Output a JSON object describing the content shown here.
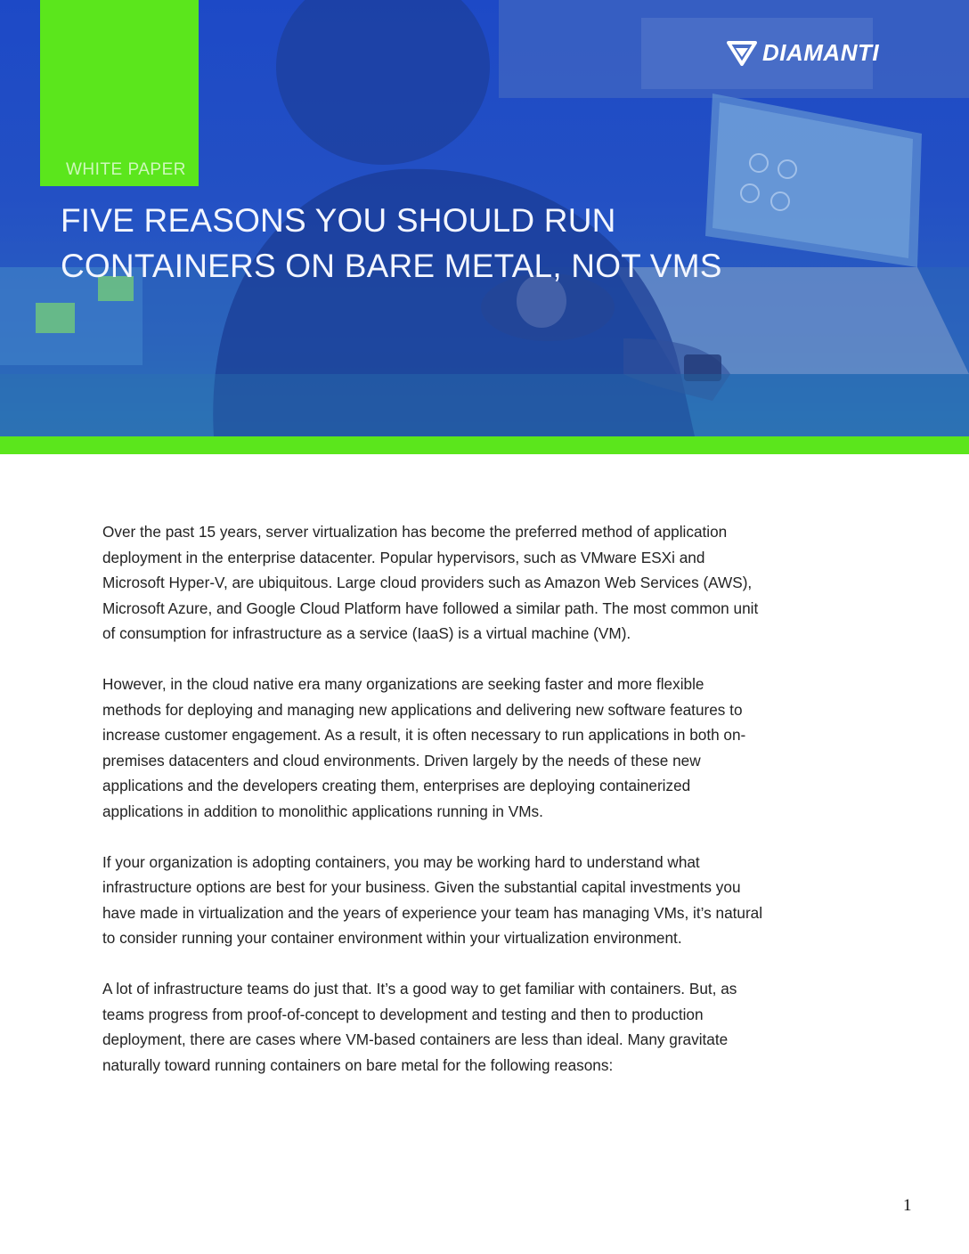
{
  "header": {
    "label": "WHITE PAPER",
    "title_line1": "FIVE REASONS YOU SHOULD RUN",
    "title_line2": "CONTAINERS ON BARE METAL, NOT VMS",
    "logo_text": "DIAMANTI",
    "logo_icon": "diamond-icon"
  },
  "colors": {
    "accent_green": "#5be61c",
    "hero_blue": "#1d49c6"
  },
  "body": {
    "paragraphs": [
      "Over the past 15 years, server virtualization has become the preferred method of application deployment in the enterprise datacenter. Popular hypervisors, such as VMware ESXi and Microsoft Hyper-V, are ubiquitous. Large cloud providers such as Amazon Web Services (AWS), Microsoft Azure, and Google Cloud Platform have followed a similar path. The most common unit of consumption for infrastructure as a service (IaaS) is a virtual machine (VM).",
      "However, in the cloud native era many organizations are seeking faster and more flexible methods for deploying and managing new applications and delivering new software features to increase customer engagement. As a result, it is often necessary to run applications in both on-premises datacenters and cloud environments. Driven largely by the needs of these new applications and the developers creating them, enterprises are deploying containerized applications in addition to monolithic applications running in VMs.",
      "If your organization is adopting containers, you may be working hard to understand what infrastructure options are best for your business. Given the substantial capital investments you have made in virtualization and the years of experience your team has managing VMs, it’s natural to consider running your container environment within your virtualization environment.",
      "A lot of infrastructure teams do just that. It’s a good way to get familiar with containers. But, as teams progress from proof-of-concept to development and testing and then to production deployment, there are cases where VM-based containers are less than ideal. Many gravitate naturally toward running containers on bare metal for the following reasons:"
    ]
  },
  "footer": {
    "page_number": "1"
  }
}
